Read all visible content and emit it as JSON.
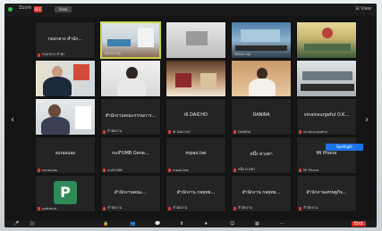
{
  "window": {
    "title": "Zoom",
    "rec_label": "REC",
    "view_label": "View",
    "view_top": "⊞ View"
  },
  "nav": {
    "left_arrow": "‹",
    "right_arrow": "›"
  },
  "tiles": [
    {
      "id": "r1c1",
      "name": "กองกลาง สำนัก...",
      "label": "กองกลาง สำนัก"
    },
    {
      "id": "r1c2",
      "name": "",
      "label": "ห้องประชุม"
    },
    {
      "id": "r1c3",
      "name": "",
      "label": ""
    },
    {
      "id": "r1c4",
      "name": "",
      "label": "ห้องประชุม"
    },
    {
      "id": "r1c5",
      "name": "",
      "label": ""
    },
    {
      "id": "r2c1",
      "name": "",
      "label": ""
    },
    {
      "id": "r2c2",
      "name": "",
      "label": ""
    },
    {
      "id": "r2c3",
      "name": "",
      "label": ""
    },
    {
      "id": "r2c4",
      "name": "",
      "label": ""
    },
    {
      "id": "r2c5",
      "name": "",
      "label": ""
    },
    {
      "id": "r3c1",
      "name": "",
      "label": ""
    },
    {
      "id": "r3c2",
      "name": "สำนักงานคณะกรรมการ...",
      "label": "สำนักงาน"
    },
    {
      "id": "r3c3",
      "name": "i6 DAICHO",
      "label": "i6 DAICHO"
    },
    {
      "id": "r3c4",
      "name": "DANIRA",
      "label": "DANIRA"
    },
    {
      "id": "r3c5",
      "name": "vinainsurgeful O.K...",
      "label": "vinainsurgeful"
    },
    {
      "id": "r4c1",
      "name": "surasuas",
      "label": "surasuas"
    },
    {
      "id": "r4c2",
      "name": "nuiFUMB Gene...",
      "label": "nuiFUMB"
    },
    {
      "id": "r4c3",
      "name": "mpao.tas",
      "label": "mpao.tas"
    },
    {
      "id": "r4c4",
      "name": "หนึ่ง ดวงตา",
      "label": "หนึ่ง ดวงตา"
    },
    {
      "id": "r4c5",
      "name": "Mi Phone",
      "label": "Mi Phone"
    },
    {
      "id": "r5c1",
      "name": "",
      "label": "pattanat"
    },
    {
      "id": "r5c2",
      "name": "สำนักงานคณะ...",
      "label": "สำนักงาน"
    },
    {
      "id": "r5c3",
      "name": "สำนักงาน กลยุทธ...",
      "label": "สำนักงาน"
    },
    {
      "id": "r5c4",
      "name": "สำนักงาน กลยุทธ...",
      "label": "สำนักงาน"
    },
    {
      "id": "r5c5",
      "name": "สำนักงานเศรษฐกิจ...",
      "label": "สำนักงาน"
    }
  ],
  "badge": {
    "text": "Spotlight"
  },
  "avatar": {
    "letter": "P"
  },
  "toolbar": {
    "mute": "🎤",
    "video": "🎥",
    "security": "🔒",
    "participants": "👥",
    "chat": "💬",
    "share": "⬆",
    "record": "⏺",
    "reactions": "☺",
    "apps": "▦",
    "more": "⋯",
    "end": "End"
  }
}
